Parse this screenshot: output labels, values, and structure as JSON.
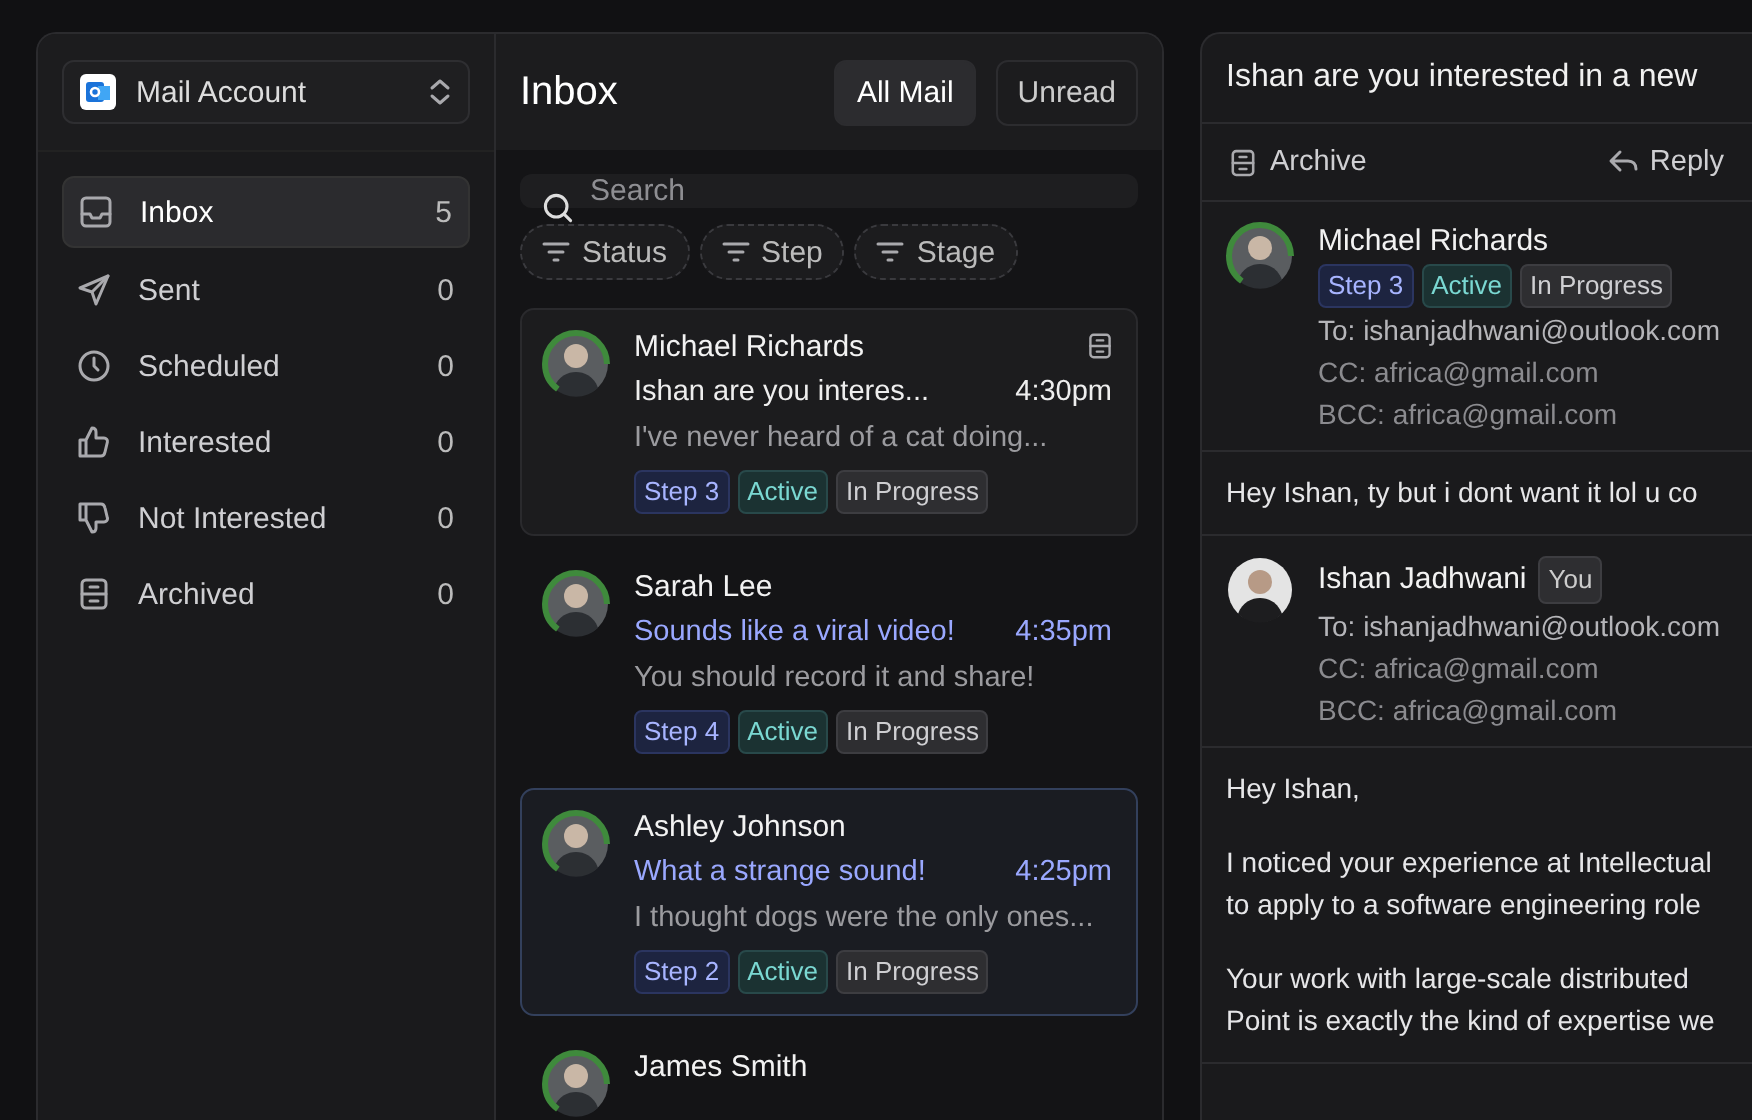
{
  "sidebar": {
    "account": "Mail Account",
    "items": [
      {
        "label": "Inbox",
        "count": "5",
        "selected": true
      },
      {
        "label": "Sent",
        "count": "0",
        "selected": false
      },
      {
        "label": "Scheduled",
        "count": "0",
        "selected": false
      },
      {
        "label": "Interested",
        "count": "0",
        "selected": false
      },
      {
        "label": "Not Interested",
        "count": "0",
        "selected": false
      },
      {
        "label": "Archived",
        "count": "0",
        "selected": false
      }
    ]
  },
  "list": {
    "title": "Inbox",
    "tabs": [
      {
        "label": "All Mail",
        "selected": true
      },
      {
        "label": "Unread",
        "selected": false
      }
    ],
    "search": {
      "placeholder": "Search"
    },
    "filters": [
      "Status",
      "Step",
      "Stage"
    ],
    "items": [
      {
        "name": "Michael Richards",
        "open_to_work": true,
        "subject": "Ishan are you interes...",
        "time": "4:30pm",
        "preview": "I've never heard of a cat doing...",
        "unread": false,
        "hovered": true,
        "selected": false,
        "tags": [
          {
            "label": "Step 3",
            "kind": "step"
          },
          {
            "label": "Active",
            "kind": "status"
          },
          {
            "label": "In Progress",
            "kind": "stage"
          }
        ]
      },
      {
        "name": "Sarah Lee",
        "open_to_work": true,
        "subject": "Sounds like a viral video!",
        "time": "4:35pm",
        "preview": "You should record it and share!",
        "unread": true,
        "hovered": false,
        "selected": false,
        "tags": [
          {
            "label": "Step 4",
            "kind": "step"
          },
          {
            "label": "Active",
            "kind": "status"
          },
          {
            "label": "In Progress",
            "kind": "stage"
          }
        ]
      },
      {
        "name": "Ashley Johnson",
        "open_to_work": true,
        "subject": "What a strange sound!",
        "time": "4:25pm",
        "preview": "I thought dogs were the only ones...",
        "unread": true,
        "hovered": false,
        "selected": true,
        "tags": [
          {
            "label": "Step 2",
            "kind": "step"
          },
          {
            "label": "Active",
            "kind": "status"
          },
          {
            "label": "In Progress",
            "kind": "stage"
          }
        ]
      },
      {
        "name": "James Smith",
        "open_to_work": true,
        "hovered": false,
        "selected": false
      }
    ]
  },
  "reader": {
    "subject": "Ishan are you interested in a new",
    "actions": [
      "Archive",
      "Reply"
    ],
    "messages": [
      {
        "sender": "Michael Richards",
        "open_to_work": true,
        "tags": [
          {
            "label": "Step 3",
            "kind": "step"
          },
          {
            "label": "Active",
            "kind": "status"
          },
          {
            "label": "In Progress",
            "kind": "stage"
          }
        ],
        "to": "To: ishanjadhwani@outlook.com",
        "cc": "CC: africa@gmail.com",
        "bcc": "BCC: africa@gmail.com",
        "body": [
          [
            "Hey Ishan, ty but i dont want it lol u co"
          ]
        ]
      },
      {
        "sender": "Ishan Jadhwani",
        "badge": "You",
        "open_to_work": false,
        "to": "To: ishanjadhwani@outlook.com",
        "cc": "CC: africa@gmail.com",
        "bcc": "BCC: africa@gmail.com",
        "body": [
          [
            "Hey Ishan,"
          ],
          [
            "I noticed your experience at Intellectual",
            "to apply to a software engineering role"
          ],
          [
            "Your work with large-scale distributed",
            "Point is exactly the kind of expertise we"
          ]
        ]
      }
    ]
  }
}
